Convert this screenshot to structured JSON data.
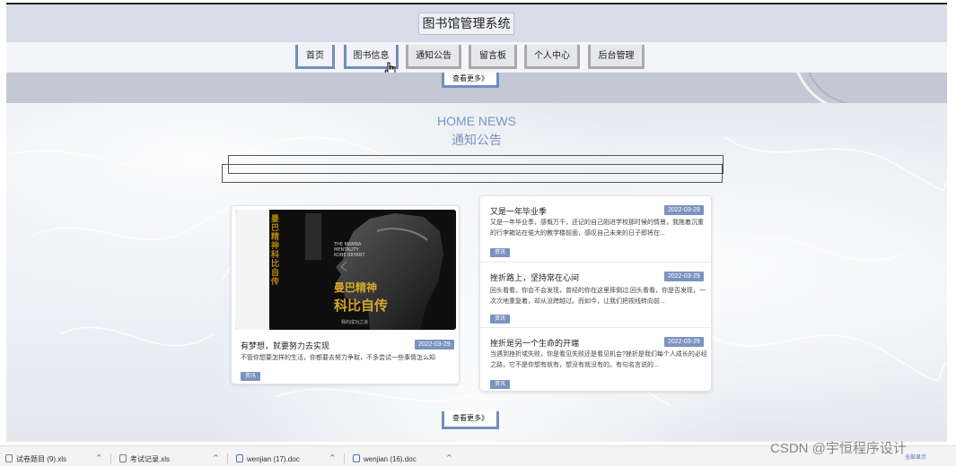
{
  "header": {
    "title": "图书馆管理系统"
  },
  "nav": {
    "items": [
      {
        "label": "首页"
      },
      {
        "label": "图书信息"
      },
      {
        "label": "通知公告"
      },
      {
        "label": "留言板"
      },
      {
        "label": "个人中心"
      },
      {
        "label": "后台管理"
      }
    ]
  },
  "more_label": "查看更多》",
  "section": {
    "title_en": "HOME NEWS",
    "title_cn": "通知公告"
  },
  "news": {
    "featured": {
      "title": "有梦想，就要努力去实现",
      "date": "2022-03-29",
      "excerpt": "不管你想要怎样的生活，你都要去努力争取，不多尝试一些事情怎么知",
      "tag": "资讯",
      "cover": {
        "spine_text": "曼巴精神 科比自传",
        "cover_title_cn": "曼巴精神",
        "cover_subtitle_cn": "科比自传",
        "cover_en": "THE MAMBA MENTALITY KOBE BRYANT",
        "cover_footer": "我的成功之道"
      }
    },
    "list": [
      {
        "title": "又是一年毕业季",
        "date": "2022-03-29",
        "excerpt": "又是一年毕业季，感慨万千，还记的自己刚进学校那时候的情景，我拖着沉重的行李箱站在偌大的教学楼前面，感叹自己未来的日子即将在...",
        "tag": "资讯"
      },
      {
        "title": "挫折路上，坚持常在心间",
        "date": "2022-03-29",
        "excerpt": "回头看看，你会不会发现，曾经的你在这里摔倒过;回头看看，你是否发现，一次次地重复着，却从没跨越过。而如今，让我们把视线转向前...",
        "tag": "资讯"
      },
      {
        "title": "挫折是另一个生命的开端",
        "date": "2022-03-29",
        "excerpt": "当遇到挫折或失败，你是看见失败还是看见机会?挫折是我们每个人成长的必经之路，它不是你想有就有，想没有就没有的。有句名言说的...",
        "tag": "资讯"
      }
    ]
  },
  "taskbar": {
    "downloads": [
      {
        "name": "试卷题目 (9).xls"
      },
      {
        "name": "考试记录.xls"
      },
      {
        "name": "wenjian (17).doc"
      },
      {
        "name": "wenjian (16).doc"
      }
    ],
    "show_all": "全部显示"
  },
  "watermark": "CSDN @宇恒程序设计",
  "colors": {
    "accent": "#7b93bf",
    "nav_border_blue": "#6f8fbd",
    "title_bar": "#d7dce8"
  }
}
